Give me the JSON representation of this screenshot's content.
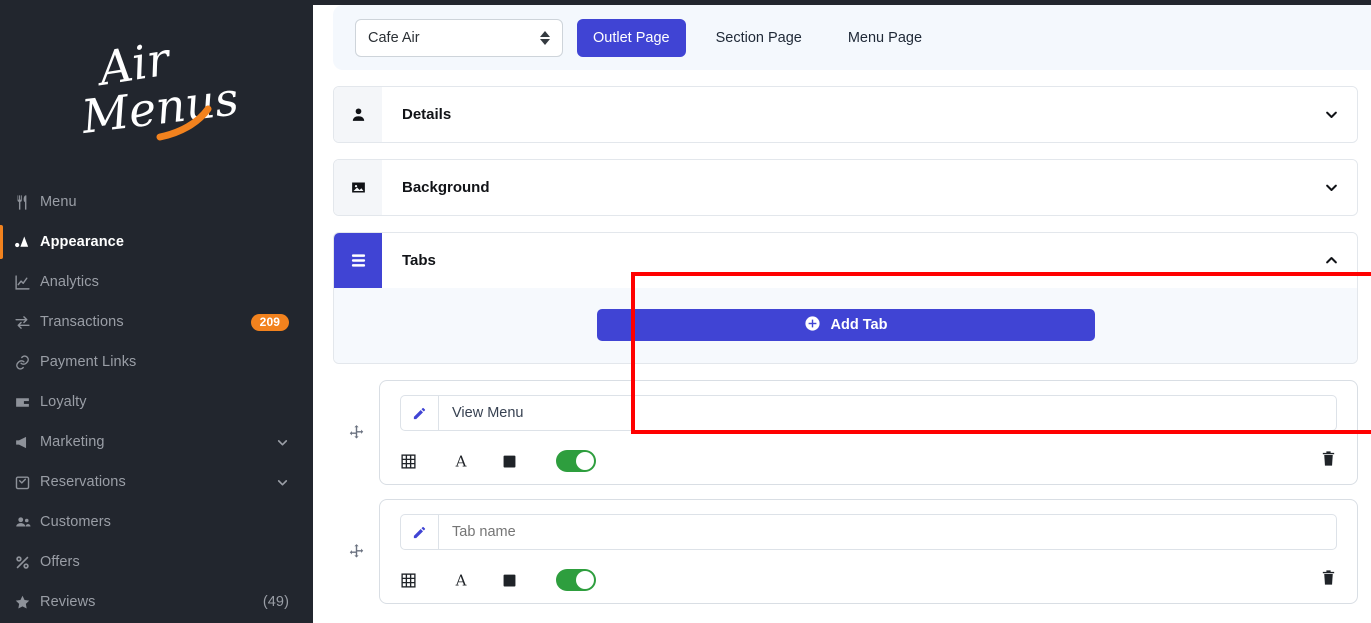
{
  "brand": {
    "logo_text_line1": "Air",
    "logo_text_line2": "Menus",
    "accent": "#f2821e"
  },
  "theme": {
    "indigo": "#4044d4",
    "sidebar_bg": "#22262e",
    "panel_bg": "#f6f9fd",
    "toggle_on": "#2e9e3e",
    "annotation": "#ff0000"
  },
  "sidebar": {
    "items": [
      {
        "label": "Menu",
        "icon": "cutlery-icon",
        "active": false,
        "badge": "",
        "count": "",
        "chevron": false
      },
      {
        "label": "Appearance",
        "icon": "palette-icon",
        "active": true,
        "badge": "",
        "count": "",
        "chevron": false
      },
      {
        "label": "Analytics",
        "icon": "chart-line-icon",
        "active": false,
        "badge": "",
        "count": "",
        "chevron": false
      },
      {
        "label": "Transactions",
        "icon": "exchange-icon",
        "active": false,
        "badge": "209",
        "count": "",
        "chevron": false
      },
      {
        "label": "Payment Links",
        "icon": "link-icon",
        "active": false,
        "badge": "",
        "count": "",
        "chevron": false
      },
      {
        "label": "Loyalty",
        "icon": "wallet-icon",
        "active": false,
        "badge": "",
        "count": "",
        "chevron": false
      },
      {
        "label": "Marketing",
        "icon": "megaphone-icon",
        "active": false,
        "badge": "",
        "count": "",
        "chevron": true
      },
      {
        "label": "Reservations",
        "icon": "calendar-check-icon",
        "active": false,
        "badge": "",
        "count": "",
        "chevron": true
      },
      {
        "label": "Customers",
        "icon": "users-icon",
        "active": false,
        "badge": "",
        "count": "",
        "chevron": false
      },
      {
        "label": "Offers",
        "icon": "percent-icon",
        "active": false,
        "badge": "",
        "count": "",
        "chevron": false
      },
      {
        "label": "Reviews",
        "icon": "star-icon",
        "active": false,
        "badge": "",
        "count": "(49)",
        "chevron": false
      }
    ]
  },
  "toolbar": {
    "outlet_select": {
      "value": "Cafe Air",
      "options": [
        "Cafe Air"
      ]
    },
    "tabs": [
      {
        "label": "Outlet Page",
        "active": true
      },
      {
        "label": "Section Page",
        "active": false
      },
      {
        "label": "Menu Page",
        "active": false
      }
    ]
  },
  "sections": [
    {
      "title": "Details",
      "icon": "person-icon",
      "expanded": false,
      "chevron": "chevron-down-icon"
    },
    {
      "title": "Background",
      "icon": "image-icon",
      "expanded": false,
      "chevron": "chevron-down-icon"
    },
    {
      "title": "Tabs",
      "icon": "hamburger-icon",
      "expanded": true,
      "chevron": "chevron-up-icon"
    }
  ],
  "tabs_panel": {
    "add_button_label": "Add Tab",
    "add_button_icon": "plus-circle-icon",
    "items": [
      {
        "name": "View Menu",
        "placeholder": "Tab name",
        "edit_icon": "pencil-icon",
        "drag_icon": "move-handle-icon",
        "tools": [
          "grid-icon",
          "text-format-icon",
          "color-swatch-icon"
        ],
        "enabled": true,
        "delete_icon": "trash-icon"
      },
      {
        "name": "",
        "placeholder": "Tab name",
        "edit_icon": "pencil-icon",
        "drag_icon": "move-handle-icon",
        "tools": [
          "grid-icon",
          "text-format-icon",
          "color-swatch-icon"
        ],
        "enabled": true,
        "delete_icon": "trash-icon"
      }
    ]
  }
}
